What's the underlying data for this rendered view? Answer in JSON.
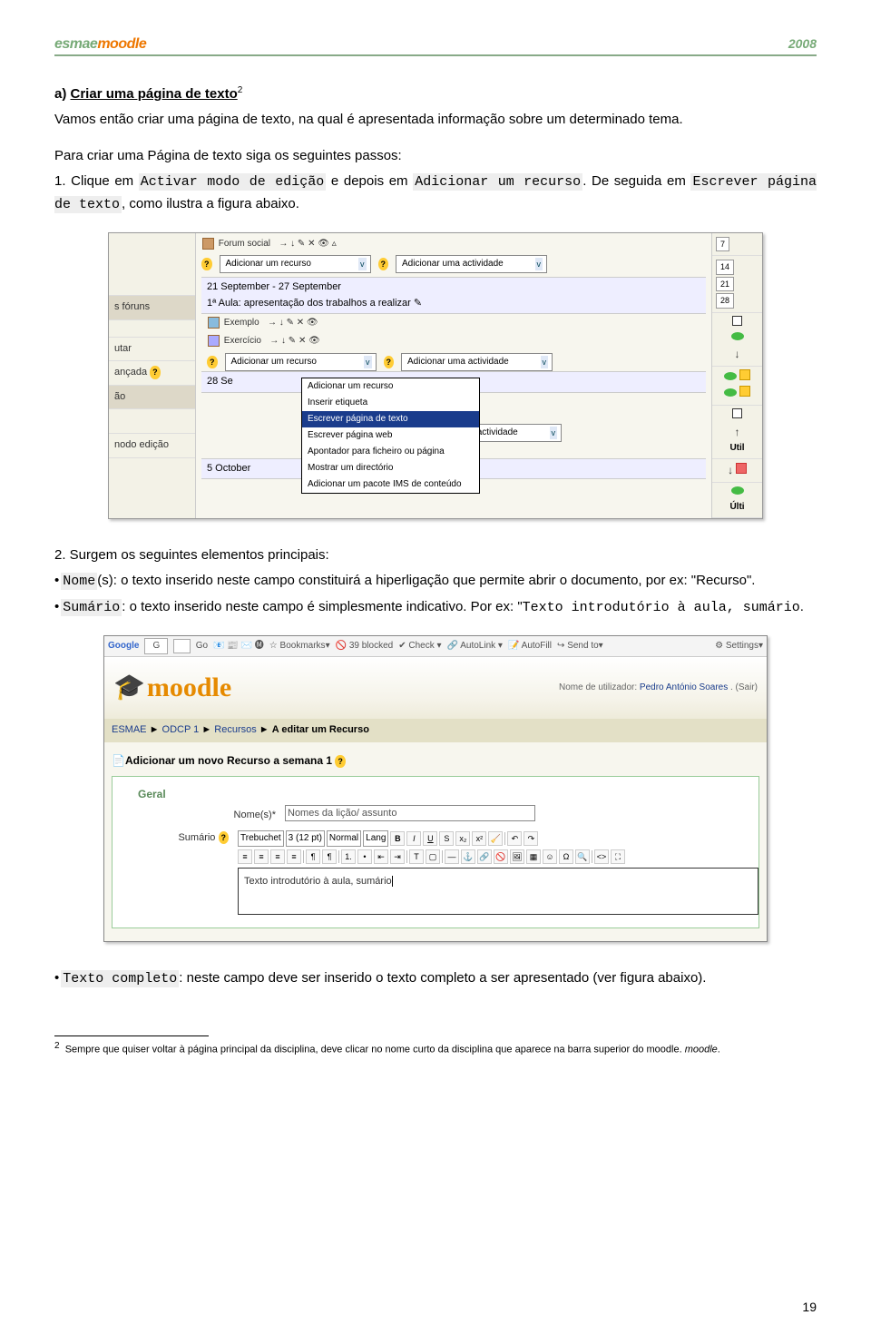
{
  "header": {
    "logo": "esmaemoodle",
    "year": "2008"
  },
  "section": {
    "heading_prefix": "a) ",
    "heading": "Criar uma página de texto",
    "heading_footref": "2",
    "p1": "Vamos então criar uma página de texto, na qual é apresentada informação sobre um determinado tema.",
    "p2": "Para criar uma Página de texto siga os seguintes passos:",
    "step1_pre": "1. Clique em ",
    "step1_code1": "Activar modo de edição",
    "step1_mid": " e depois em ",
    "step1_code2": "Adicionar um recurso",
    "step1_post": ". De seguida em ",
    "step1_code3": "Escrever página de texto",
    "step1_end": ", como ilustra a figura abaixo.",
    "step2_intro": "2. Surgem os seguintes elementos principais:",
    "nome_label": "Nome",
    "nome_text": "(s): o texto inserido neste campo constituirá a hiperligação que permite abrir o documento, por ex: \"Recurso\".",
    "sumario_label": "Sumário",
    "sumario_text1": ": o texto inserido neste campo é simplesmente indicativo. Por ex: \"",
    "sumario_code": "Texto introdutório à aula, sumário",
    "sumario_text2": ".",
    "texto_label": "Texto completo",
    "texto_text": ": neste campo deve ser inserido o texto completo a ser apresentado (ver figura abaixo)."
  },
  "shot1": {
    "forum_social": "Forum social",
    "sel_recurso": "Adicionar um recurso",
    "sel_actividade": "Adicionar uma actividade",
    "dates": "21 September - 27 September",
    "aula1": "1ª Aula: apresentação dos trabalhos a realizar",
    "exemplo": "Exemplo",
    "exercicio": "Exercício",
    "date28": "28 Se",
    "date5oct": "5 October",
    "left_foruns": "s fóruns",
    "left_utar": "utar",
    "left_anc": "ançada",
    "left_ao": "ão",
    "left_modo": "nodo edição",
    "dropdown": {
      "items": [
        "Adicionar um recurso",
        "Inserir etiqueta",
        "Escrever página de texto",
        "Escrever página web",
        "Apontador para ficheiro ou página",
        "Mostrar um directório",
        "Adicionar um pacote IMS de conteúdo"
      ],
      "selected_index": 2
    },
    "cal_days": [
      "7",
      "14",
      "21",
      "28"
    ],
    "util": "Util",
    "ulti": "Últi"
  },
  "shot2": {
    "toolbar": {
      "google": "Google",
      "g": "G",
      "go": "Go",
      "bookmarks": "Bookmarks",
      "blocked": "39 blocked",
      "check": "Check",
      "autolink": "AutoLink",
      "autofill": "AutoFill",
      "sendto": "Send to",
      "settings": "Settings"
    },
    "userline_pre": "Nome de utilizador: ",
    "userline_name": "Pedro António Soares",
    "userline_post": " . (Sair)",
    "logo": "moodle",
    "crumb": [
      "ESMAE",
      "ODCP 1",
      "Recursos",
      "A editar um Recurso"
    ],
    "crumb_sep": " ► ",
    "form_title": "Adicionar um novo Recurso a semana 1",
    "legend": "Geral",
    "nome_label": "Nome(s)*",
    "nome_value": "Nomes da lição/ assunto",
    "sumario_label": "Sumário",
    "editor": {
      "font": "Trebuchet",
      "size": "3 (12 pt)",
      "style": "Normal",
      "lang": "Lang",
      "content": "Texto introdutório à aula, sumário"
    }
  },
  "footnote": {
    "ref": "2",
    "text": "Sempre que quiser voltar à página principal da disciplina, deve clicar no nome curto da disciplina que aparece na barra superior do moodle."
  },
  "page_num": "19"
}
